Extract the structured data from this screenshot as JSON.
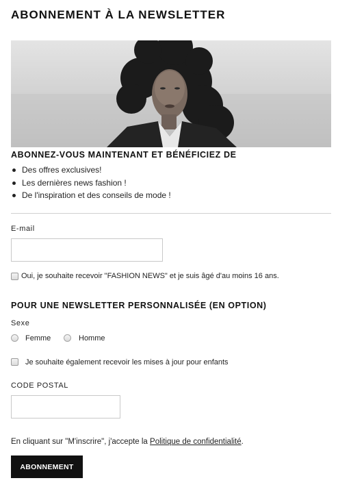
{
  "page": {
    "title": "ABONNEMENT À LA NEWSLETTER"
  },
  "hero": {
    "image": "woman-portrait-photo"
  },
  "benefits": {
    "title": "ABONNEZ-VOUS MAINTENANT ET BÉNÉFICIEZ DE",
    "items": [
      {
        "text": "Des offres exclusives!"
      },
      {
        "text": "Les dernières news fashion !"
      },
      {
        "text": "De l'inspiration et des conseils de mode !"
      }
    ]
  },
  "email": {
    "label": "E-mail",
    "value": "",
    "placeholder": "",
    "consent_label": "Oui, je souhaite recevoir \"FASHION NEWS\" et je suis âgé d'au moins 16 ans.",
    "consent_checked": false
  },
  "personalized": {
    "title": "POUR UNE NEWSLETTER PERSONNALISÉE (EN OPTION)",
    "gender_label": "Sexe",
    "gender_options": [
      {
        "label": "Femme",
        "selected": false
      },
      {
        "label": "Homme",
        "selected": false
      }
    ],
    "kids_label": "Je souhaite également recevoir les mises à jour pour enfants",
    "kids_checked": false,
    "postal_label": "CODE POSTAL",
    "postal_value": "",
    "postal_placeholder": ""
  },
  "legal": {
    "prefix": "En cliquant sur \"M'inscrire\", j'accepte la ",
    "link": "Politique de confidentialité",
    "suffix": "."
  },
  "submit": {
    "label": "ABONNEMENT"
  },
  "colors": {
    "button_bg": "#111111",
    "divider": "#cfcfcf",
    "input_border": "#c8c8c8"
  }
}
